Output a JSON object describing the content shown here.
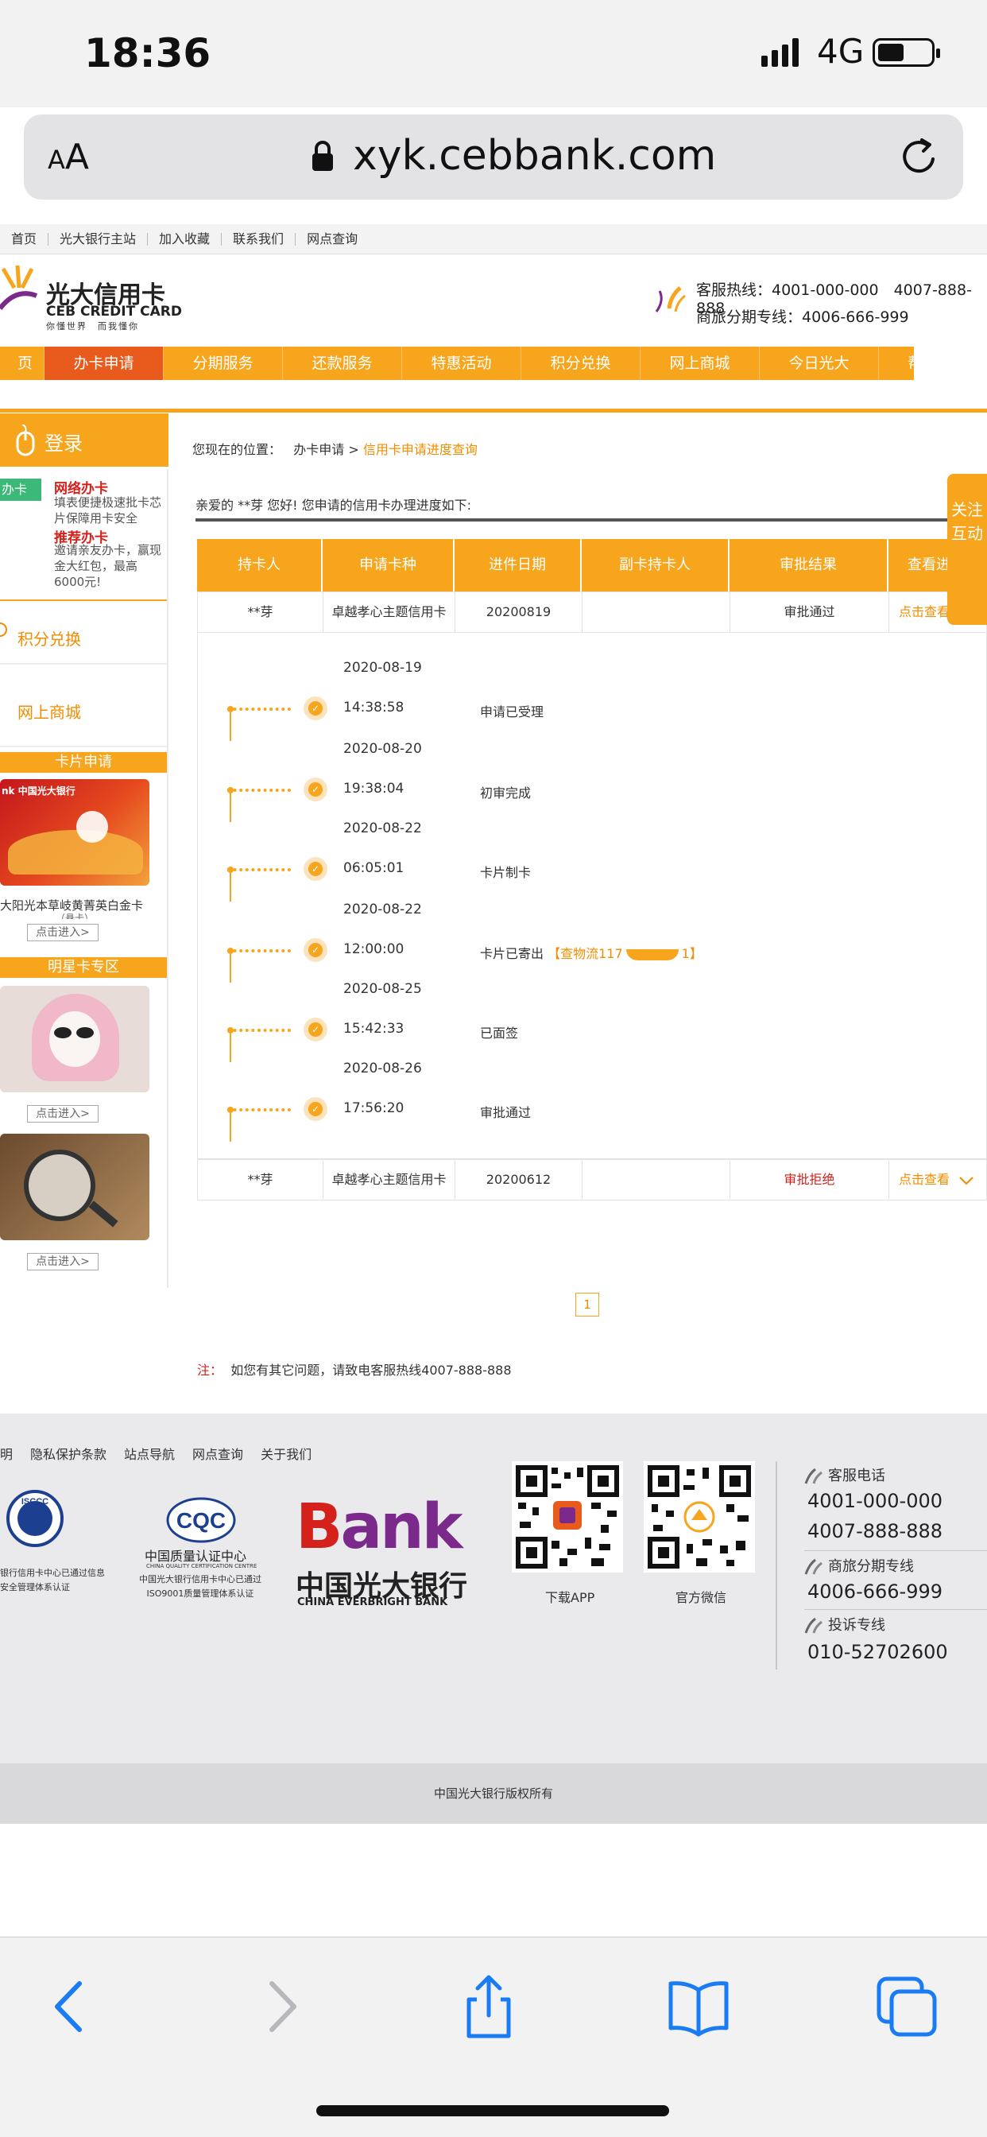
{
  "status": {
    "time": "18:36",
    "network": "4G"
  },
  "browser": {
    "aa_label_small": "A",
    "aa_label_big": "A",
    "url": "xyk.cebbank.com"
  },
  "topnav": [
    "首页",
    "光大银行主站",
    "加入收藏",
    "联系我们",
    "网点查询"
  ],
  "logo": {
    "cn": "光大信用卡",
    "en": "CEB CREDIT CARD",
    "slogan": "你懂世界　而我懂你"
  },
  "hotline": {
    "line1": "客服热线：4001-000-000　4007-888-888",
    "line2": "商旅分期专线：4006-666-999"
  },
  "mainnav": [
    "页",
    "办卡申请",
    "分期服务",
    "还款服务",
    "特惠活动",
    "积分兑换",
    "网上商城",
    "今日光大",
    "帮助中心"
  ],
  "sidebar": {
    "login": "登录",
    "tag": "办卡",
    "net_title": "网络办卡",
    "net_desc": "填表便捷极速批卡芯片保障用卡安全",
    "rec_title": "推荐办卡",
    "rec_desc": "邀请亲友办卡，赢现金大红包，最高6000元!",
    "points": "积分兑换",
    "mall": "网上商城",
    "card_apply": "卡片申请",
    "card_name": "大阳光本草岐黄菁英白金卡",
    "card_name_sub": "（悬卡）",
    "enter": "点击进入>",
    "star": "明星卡专区",
    "card_brand": "中国光大银行",
    "card_logo_letters": "nk"
  },
  "breadcrumb": {
    "prefix": "您现在的位置：",
    "level1": "办卡申请",
    "sep": ">",
    "current": "信用卡申请进度查询"
  },
  "greeting": "亲爱的 **芽 您好!  您申请的信用卡办理进度如下:",
  "table": {
    "headers": [
      "持卡人",
      "申请卡种",
      "进件日期",
      "副卡持卡人",
      "审批结果",
      "查看进度"
    ],
    "rows": [
      {
        "holder": "**芽",
        "card": "卓越孝心主题信用卡",
        "date": "20200819",
        "sub": "",
        "result": "审批通过",
        "action": "点击查看"
      },
      {
        "holder": "**芽",
        "card": "卓越孝心主题信用卡",
        "date": "20200612",
        "sub": "",
        "result": "审批拒绝",
        "action": "点击查看"
      }
    ]
  },
  "timeline": [
    {
      "date": "2020-08-19",
      "time": "14:38:58",
      "event": "申请已受理"
    },
    {
      "date": "2020-08-20",
      "time": "19:38:04",
      "event": "初审完成"
    },
    {
      "date": "2020-08-22",
      "time": "06:05:01",
      "event": "卡片制卡"
    },
    {
      "date": "2020-08-22",
      "time": "12:00:00",
      "event": "卡片已寄出",
      "track": "【查物流117",
      "track_end": "1】"
    },
    {
      "date": "2020-08-25",
      "time": "15:42:33",
      "event": "已面签"
    },
    {
      "date": "2020-08-26",
      "time": "17:56:20",
      "event": "审批通过"
    }
  ],
  "pager": {
    "current": "1"
  },
  "note": {
    "label": "注：",
    "text": "如您有其它问题，请致电客服热线4007-888-888"
  },
  "follow": "关注互动",
  "footer": {
    "links": [
      "明",
      "隐私保护条款",
      "站点导航",
      "网点查询",
      "关于我们"
    ],
    "cert1_text": "银行信用卡中心已通过信息安全管理体系认证",
    "cert1_logo": "ISCCC",
    "cert2_logo": "CQC",
    "cert2_title": "中国质量认证中心",
    "cert2_en": "CHINA QUALITY CERTIFICATION CENTRE",
    "cert2_text": "中国光大银行信用卡中心已通过ISO9001质量管理体系认证",
    "bank_b": "B",
    "bank_ank": "ank",
    "bank_cn": "中国光大银行",
    "bank_en": "CHINA EVERBRIGHT BANK",
    "qr1": "下载APP",
    "qr2": "官方微信",
    "service_label": "客服电话",
    "service1": "4001-000-000",
    "service2": "4007-888-888",
    "travel_label": "商旅分期专线",
    "travel": "4006-666-999",
    "complaint_label": "投诉专线",
    "complaint": "010-52702600",
    "copyright": "中国光大银行版权所有"
  }
}
